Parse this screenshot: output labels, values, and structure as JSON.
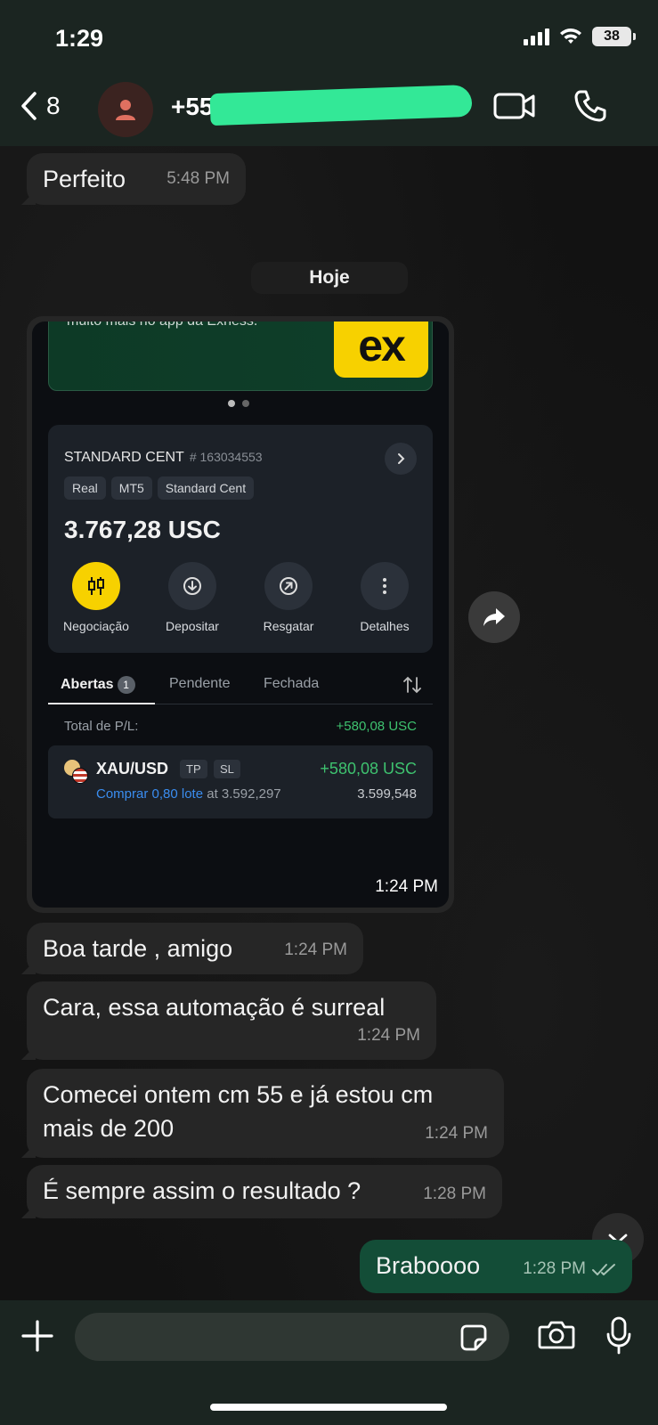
{
  "status_bar": {
    "time": "1:29",
    "battery": "38"
  },
  "header": {
    "back_count": "8",
    "contact_name": "+55 31 99"
  },
  "messages": {
    "m1": {
      "text": "Perfeito",
      "time": "5:48 PM"
    },
    "day_separator": "Hoje",
    "image": {
      "time": "1:24 PM"
    },
    "m2": {
      "text": "Boa tarde , amigo",
      "time": "1:24 PM"
    },
    "m3": {
      "text": "Cara, essa automação é surreal",
      "time": "1:24 PM"
    },
    "m4": {
      "text": "Comecei ontem cm 55 e já estou cm mais de 200",
      "time": "1:24 PM"
    },
    "m5": {
      "text": "É sempre assim o resultado ?",
      "time": "1:28 PM"
    },
    "m6": {
      "text": "Braboooo",
      "time": "1:28 PM"
    }
  },
  "screenshot": {
    "banner_text": "muito mais no app da Exness.",
    "logo_text": "ex",
    "account": {
      "name": "STANDARD CENT",
      "number": "# 163034553",
      "tags": [
        "Real",
        "MT5",
        "Standard Cent"
      ],
      "balance": "3.767,28 USC",
      "actions": [
        "Negociação",
        "Depositar",
        "Resgatar",
        "Detalhes"
      ]
    },
    "tabs": {
      "open": "Abertas",
      "open_count": "1",
      "pending": "Pendente",
      "closed": "Fechada"
    },
    "pl_label": "Total de P/L:",
    "pl_value": "+580,08 USC",
    "position": {
      "symbol": "XAU/USD",
      "tp": "TP",
      "sl": "SL",
      "pl": "+580,08 USC",
      "buy": "Comprar 0,80 lote",
      "at": "at 3.592,297",
      "current": "3.599,548"
    }
  },
  "composer": {
    "placeholder": ""
  },
  "colors": {
    "header_bg": "#1b2521",
    "bubble_in": "#262626",
    "bubble_out": "#134d37",
    "accent_yellow": "#f7d100",
    "profit_green": "#3ec26f"
  }
}
